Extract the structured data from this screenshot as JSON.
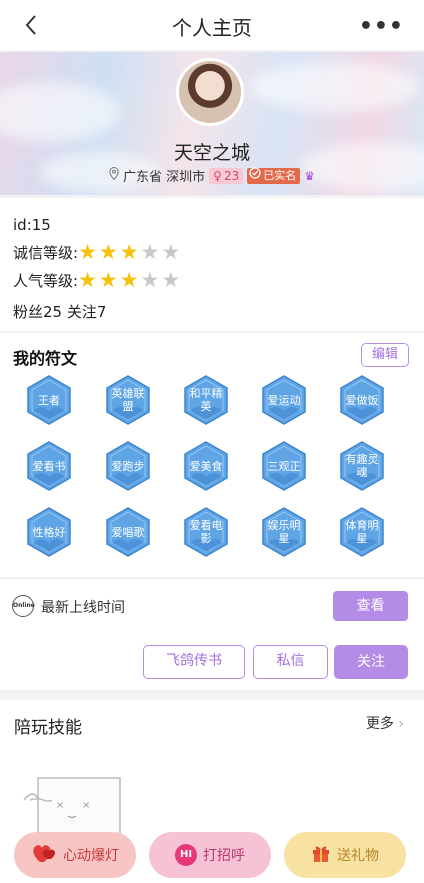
{
  "header": {
    "title": "个人主页",
    "more": "•••"
  },
  "profile": {
    "nickname": "天空之城",
    "location": "广东省 深圳市",
    "age": "23",
    "verified": "已实名"
  },
  "info": {
    "id": "id:15",
    "credit_label": "诚信等级:",
    "credit_stars": 3,
    "popularity_label": "人气等级:",
    "popularity_stars": 3,
    "max_stars": 5,
    "fans_follow": "粉丝25  关注7"
  },
  "runes": {
    "title": "我的符文",
    "edit": "编辑",
    "items": [
      "王者",
      "英雄联盟",
      "和平精英",
      "爱运动",
      "爱做饭",
      "爱看书",
      "爱跑步",
      "爱美食",
      "三观正",
      "有趣灵魂",
      "性格好",
      "爱唱歌",
      "爱看电影",
      "娱乐明星",
      "体育明星"
    ]
  },
  "online": {
    "icon_text": "Online",
    "label": "最新上线时间",
    "view": "查看"
  },
  "actions": {
    "pigeon": "飞鸽传书",
    "message": "私信",
    "follow": "关注"
  },
  "skills": {
    "title": "陪玩技能",
    "more": "更多"
  },
  "bottom": {
    "heart": "心动爆灯",
    "hi_icon": "HI",
    "greet": "打招呼",
    "gift": "送礼物"
  },
  "colors": {
    "accent": "#b48be6",
    "star": "#f4c20d",
    "hex": "#5fa5e6"
  }
}
